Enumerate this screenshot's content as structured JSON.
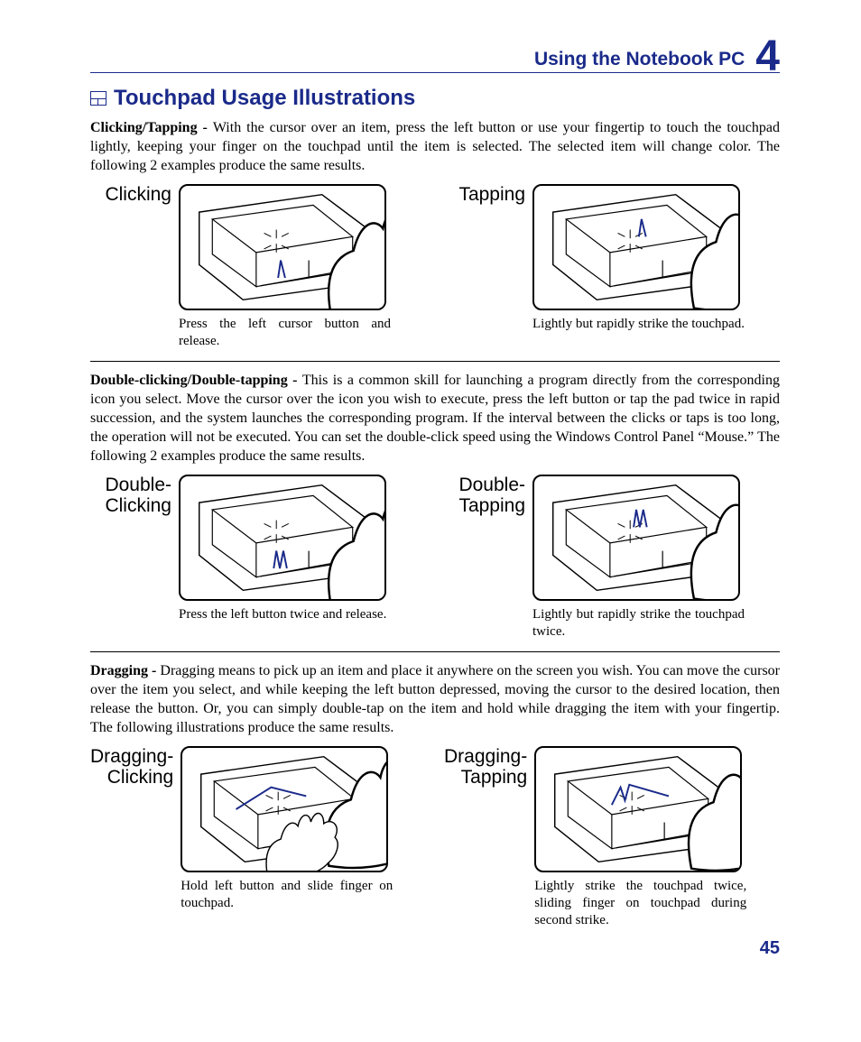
{
  "header": {
    "section": "Using the Notebook PC",
    "chapter": "4"
  },
  "title": "Touchpad Usage Illustrations",
  "page_number": "45",
  "blocks": [
    {
      "lead": "Clicking/Tapping - ",
      "text": "With the cursor over an item, press the left button or use your fingertip to touch the touchpad lightly, keeping your finger on the touchpad until the item is selected. The selected item will change color. The following 2 examples produce the same results.",
      "left": {
        "label": "Clicking",
        "caption": "Press the left cursor button and release."
      },
      "right": {
        "label": "Tapping",
        "caption": "Lightly but rapidly strike the touchpad."
      }
    },
    {
      "lead": "Double-clicking/Double-tapping - ",
      "text": "This is a common skill for launching a program directly from the corresponding icon you select. Move the cursor over the icon you wish to execute, press the left button or tap the pad twice in rapid succession, and the system launches the corresponding program. If the interval between the clicks or taps is too long, the operation will not be executed. You can set the double-click speed using the Windows Control Panel “Mouse.” The following 2 examples produce the same results.",
      "left": {
        "label": "Double-\nClicking",
        "caption": "Press the left button twice and release."
      },
      "right": {
        "label": "Double-\nTapping",
        "caption": "Lightly but rapidly strike the touchpad twice."
      }
    },
    {
      "lead": "Dragging - ",
      "text": "Dragging means to pick up an item and place it anywhere on the screen you wish. You can move the cursor over the item you select, and while keeping the left button depressed, moving the cursor to the desired location, then release the button. Or, you can simply double-tap on the item and hold while dragging the item with your fingertip. The following illustrations produce the same results.",
      "left": {
        "label": "Dragging-\nClicking",
        "caption": "Hold left button and slide finger on touchpad."
      },
      "right": {
        "label": "Dragging-\nTapping",
        "caption": "Lightly strike the touchpad twice, sliding finger on touchpad during second strike."
      }
    }
  ]
}
